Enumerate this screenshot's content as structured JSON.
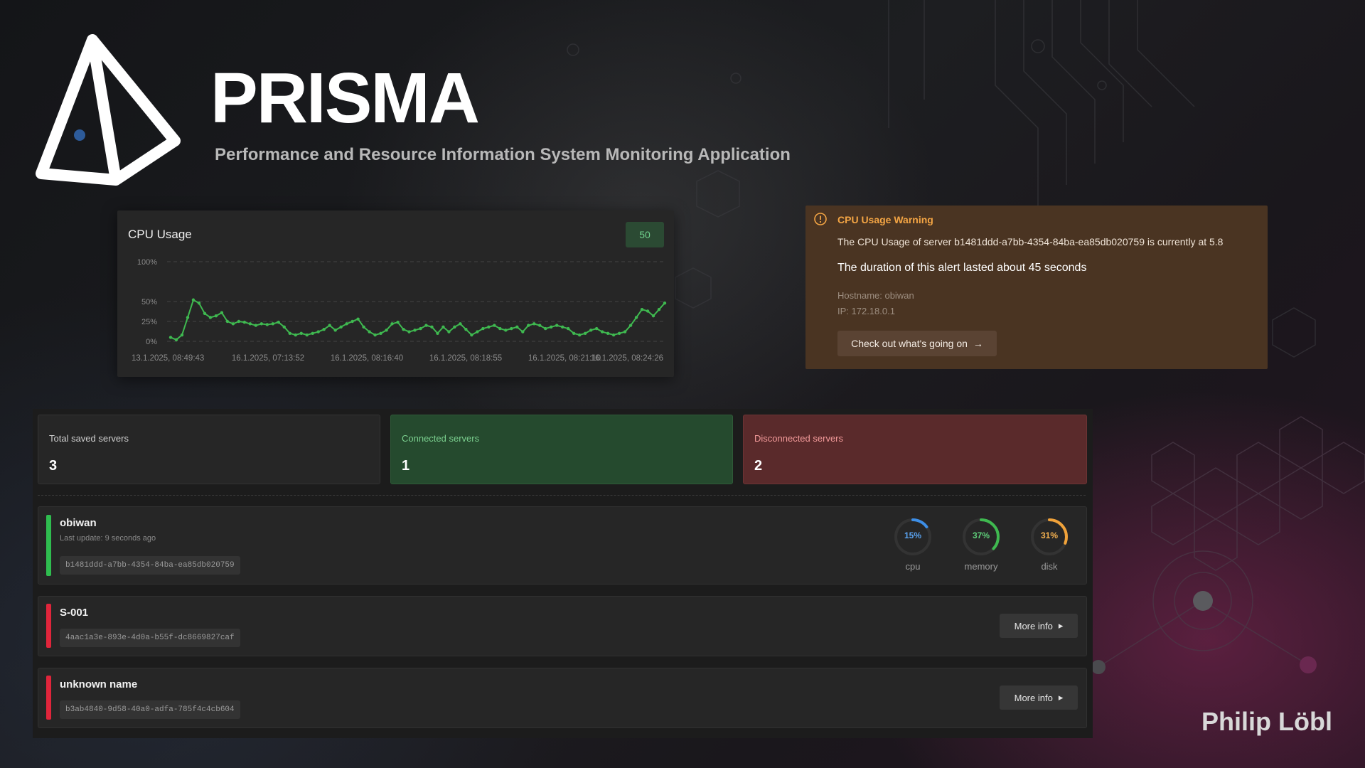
{
  "brand": {
    "title": "PRISMA",
    "subtitle": "Performance and Resource Information System Monitoring Application",
    "signature": "Philip Löbl"
  },
  "cpu_card": {
    "title": "CPU Usage",
    "badge": "50",
    "line_color": "#3fb950"
  },
  "chart_data": {
    "type": "line",
    "title": "CPU Usage",
    "y_ticks": [
      "100%",
      "50%",
      "25%",
      "0%"
    ],
    "x_ticks": [
      "13.1.2025, 08:49:43",
      "16.1.2025, 07:13:52",
      "16.1.2025, 08:16:40",
      "16.1.2025, 08:18:55",
      "16.1.2025, 08:21:10",
      "16.1.2025, 08:24:26"
    ],
    "ylim": [
      0,
      100
    ],
    "grid": true,
    "values": [
      5,
      2,
      8,
      30,
      52,
      48,
      35,
      30,
      32,
      36,
      25,
      22,
      25,
      24,
      22,
      20,
      22,
      21,
      22,
      24,
      18,
      10,
      8,
      10,
      8,
      10,
      12,
      15,
      20,
      14,
      18,
      22,
      25,
      28,
      18,
      12,
      8,
      10,
      14,
      22,
      24,
      15,
      12,
      14,
      16,
      20,
      18,
      10,
      18,
      12,
      18,
      22,
      15,
      8,
      12,
      16,
      18,
      20,
      16,
      14,
      16,
      18,
      12,
      20,
      22,
      20,
      16,
      18,
      20,
      18,
      16,
      10,
      8,
      10,
      14,
      16,
      12,
      10,
      8,
      10,
      12,
      20,
      30,
      40,
      38,
      32,
      40,
      48
    ],
    "annotation": "50"
  },
  "alert": {
    "title": "CPU Usage Warning",
    "message": "The CPU Usage of server b1481ddd-a7bb-4354-84ba-ea85db020759 is currently at 5.8",
    "duration": "The duration of this alert lasted about 45 seconds",
    "hostname": "Hostname: obiwan",
    "ip": "IP: 172.18.0.1",
    "button": "Check out what's going on",
    "accent": "#f4a544"
  },
  "stats": {
    "total": {
      "label": "Total saved servers",
      "value": "3"
    },
    "connected": {
      "label": "Connected servers",
      "value": "1"
    },
    "disconnected": {
      "label": "Disconnected servers",
      "value": "2"
    }
  },
  "servers": [
    {
      "name": "obiwan",
      "status": "connected",
      "status_color": "#2fbd4f",
      "last_update": "Last update: 9 seconds ago",
      "uuid": "b1481ddd-a7bb-4354-84ba-ea85db020759",
      "gauges": [
        {
          "label": "cpu",
          "text": "15%",
          "value": 15,
          "color": "#3d8ee6"
        },
        {
          "label": "memory",
          "text": "37%",
          "value": 37,
          "color": "#3fb950"
        },
        {
          "label": "disk",
          "text": "31%",
          "value": 31,
          "color": "#f0a23a"
        }
      ]
    },
    {
      "name": "S-001",
      "status": "disconnected",
      "status_color": "#e0253b",
      "uuid": "4aac1a3e-893e-4d0a-b55f-dc8669827caf",
      "more": "More info"
    },
    {
      "name": "unknown name",
      "status": "disconnected",
      "status_color": "#e0253b",
      "uuid": "b3ab4840-9d58-40a0-adfa-785f4c4cb604",
      "more": "More info"
    }
  ]
}
